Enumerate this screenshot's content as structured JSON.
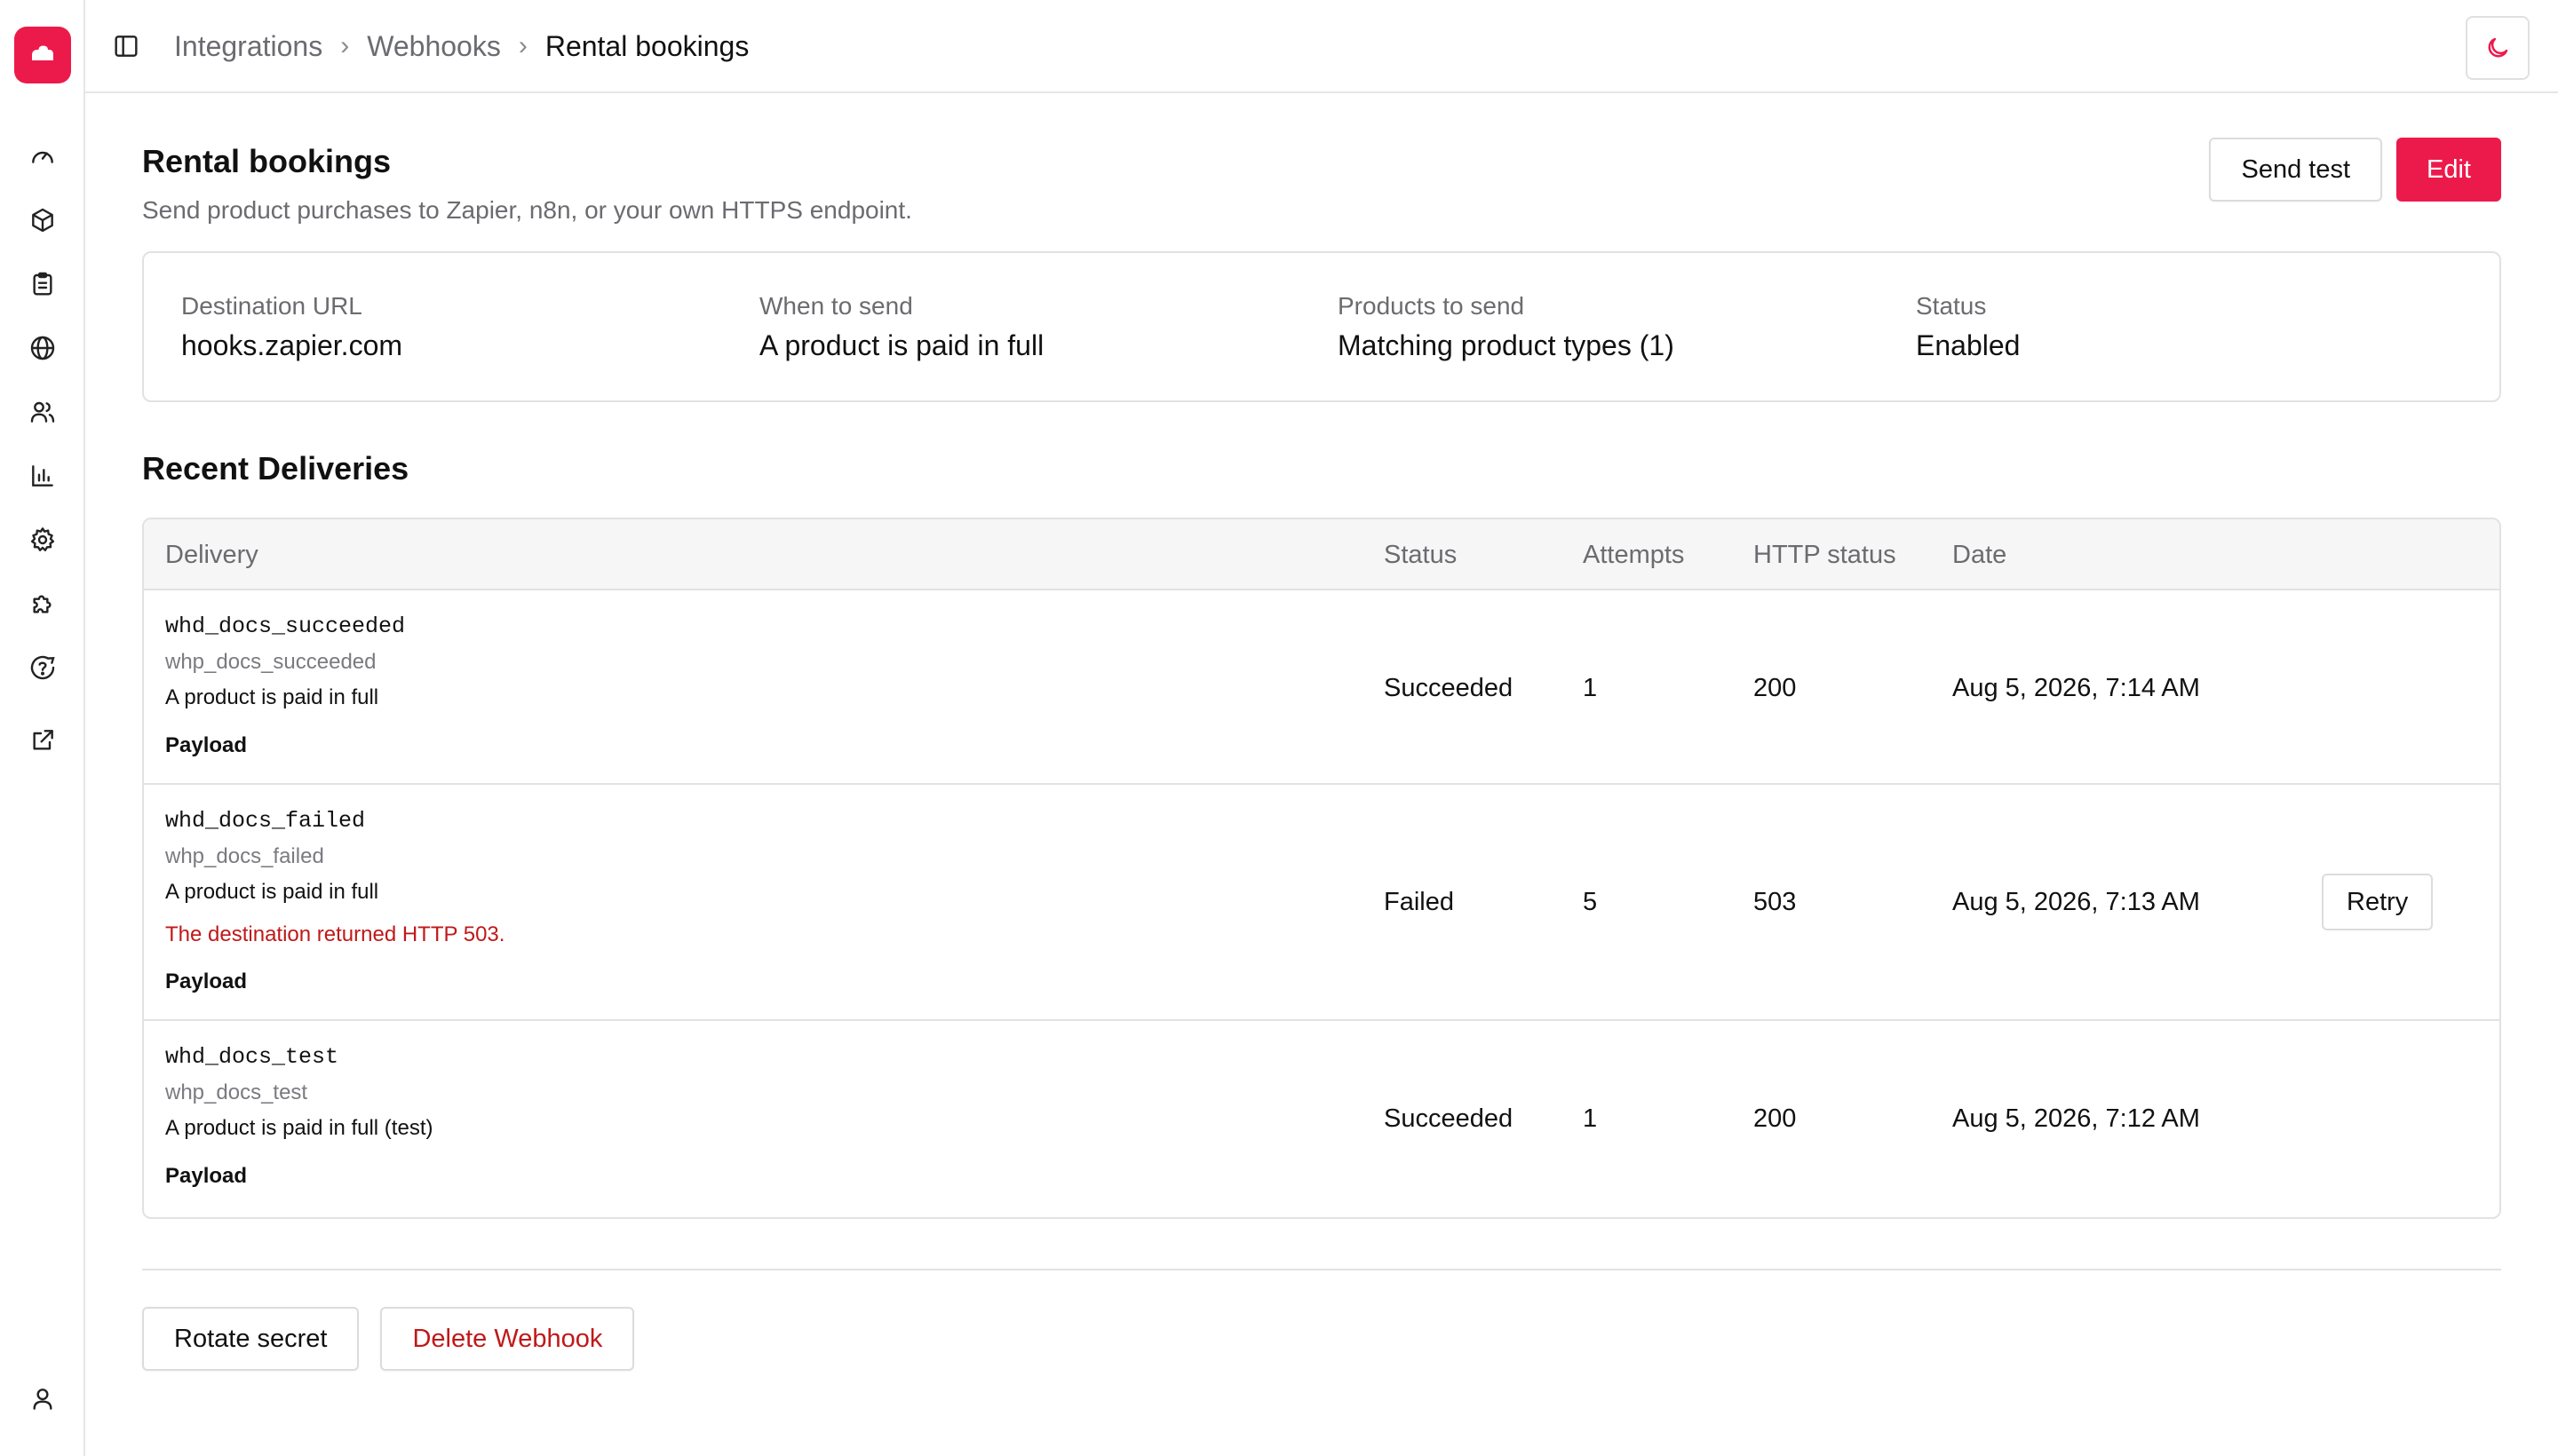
{
  "sidebar": {
    "logo": "app-logo",
    "items": [
      {
        "icon": "dashboard-gauge-icon"
      },
      {
        "icon": "package-icon"
      },
      {
        "icon": "clipboard-list-icon"
      },
      {
        "icon": "globe-icon"
      },
      {
        "icon": "users-icon"
      },
      {
        "icon": "bar-chart-icon"
      },
      {
        "icon": "settings-gear-icon"
      },
      {
        "icon": "puzzle-icon"
      },
      {
        "icon": "help-circle-icon"
      },
      {
        "icon": "external-link-icon"
      }
    ],
    "account_icon": "user-icon"
  },
  "topbar": {
    "breadcrumb": [
      "Integrations",
      "Webhooks",
      "Rental bookings"
    ],
    "separator": "›",
    "theme_icon": "moon-icon"
  },
  "page": {
    "title": "Rental bookings",
    "subtitle": "Send product purchases to Zapier, n8n, or your own HTTPS endpoint.",
    "send_test_label": "Send test",
    "edit_label": "Edit"
  },
  "info": {
    "destination_label": "Destination URL",
    "destination_value": "hooks.zapier.com",
    "when_label": "When to send",
    "when_value": "A product is paid in full",
    "products_label": "Products to send",
    "products_value": "Matching product types (1)",
    "status_label": "Status",
    "status_value": "Enabled"
  },
  "deliveries": {
    "title": "Recent Deliveries",
    "columns": [
      "Delivery",
      "Status",
      "Attempts",
      "HTTP status",
      "Date"
    ],
    "rows": [
      {
        "id": "whd_docs_succeeded",
        "webhook": "whp_docs_succeeded",
        "event": "A product is paid in full",
        "payload": "Payload",
        "status": "Succeeded",
        "attempts": "1",
        "http_status": "200",
        "date": "Aug 5, 2026, 7:14 AM"
      },
      {
        "id": "whd_docs_failed",
        "webhook": "whp_docs_failed",
        "event": "A product is paid in full",
        "error": "The destination returned HTTP 503.",
        "payload": "Payload",
        "status": "Failed",
        "attempts": "5",
        "http_status": "503",
        "date": "Aug 5, 2026, 7:13 AM",
        "action": "Retry"
      },
      {
        "id": "whd_docs_test",
        "webhook": "whp_docs_test",
        "event": "A product is paid in full (test)",
        "payload": "Payload",
        "status": "Succeeded",
        "attempts": "1",
        "http_status": "200",
        "date": "Aug 5, 2026, 7:12 AM"
      }
    ]
  },
  "footer": {
    "rotate_label": "Rotate secret",
    "delete_label": "Delete Webhook"
  },
  "colors": {
    "brand": "#ec1a4b",
    "danger": "#c01818"
  }
}
